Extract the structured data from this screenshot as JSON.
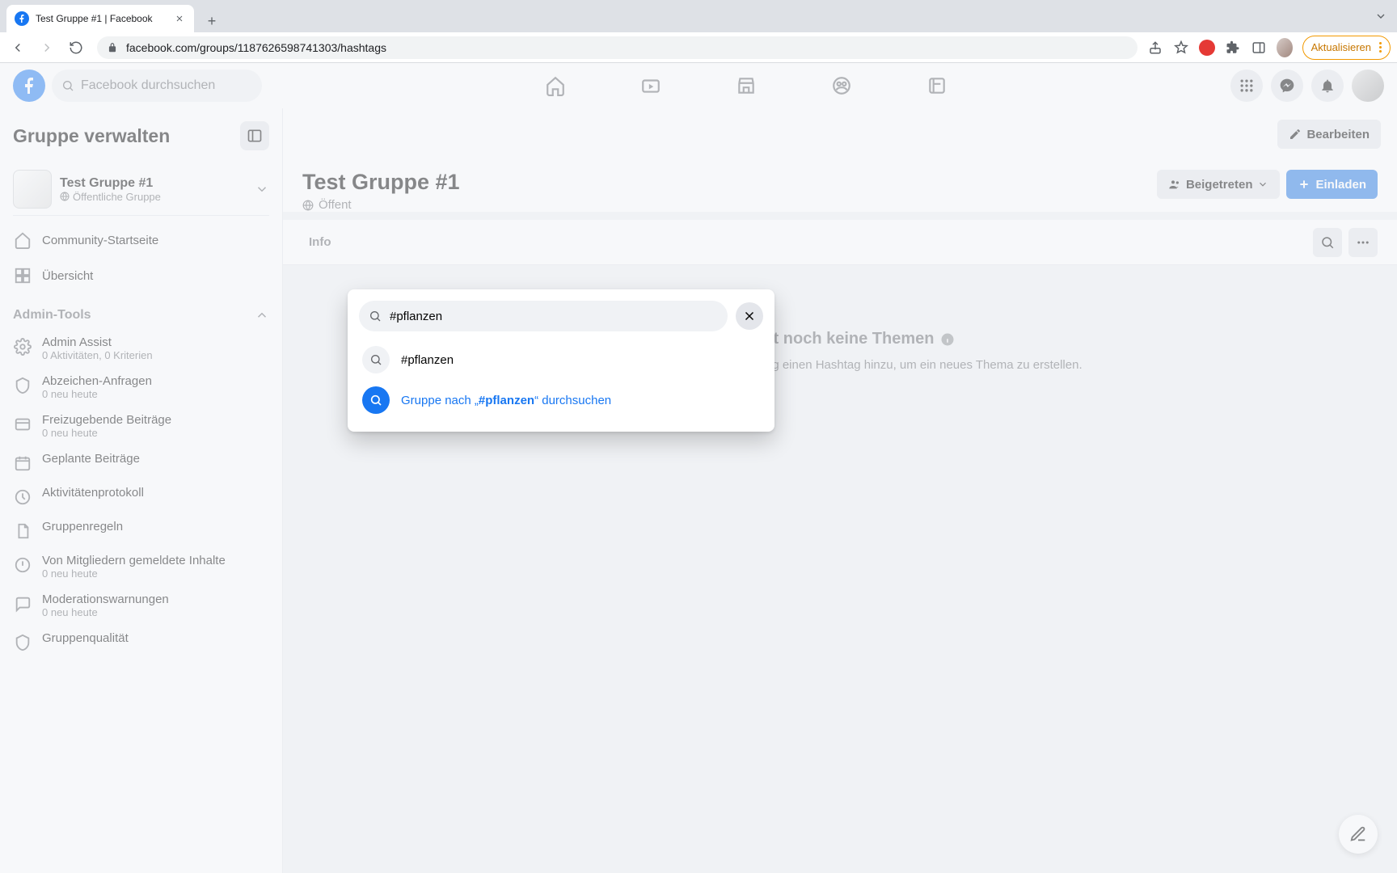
{
  "browser": {
    "tab_title": "Test Gruppe #1 | Facebook",
    "url": "facebook.com/groups/1187626598741303/hashtags",
    "update_label": "Aktualisieren"
  },
  "topnav": {
    "search_placeholder": "Facebook durchsuchen"
  },
  "sidebar": {
    "title": "Gruppe verwalten",
    "group": {
      "name": "Test Gruppe #1",
      "visibility": "Öffentliche Gruppe"
    },
    "items": [
      {
        "label": "Community-Startseite"
      },
      {
        "label": "Übersicht"
      }
    ],
    "admin_section": "Admin-Tools",
    "admin_items": [
      {
        "label": "Admin Assist",
        "sub": "0 Aktivitäten, 0 Kriterien"
      },
      {
        "label": "Abzeichen-Anfragen",
        "sub": "0 neu heute"
      },
      {
        "label": "Freizugebende Beiträge",
        "sub": "0 neu heute"
      },
      {
        "label": "Geplante Beiträge",
        "sub": ""
      },
      {
        "label": "Aktivitätenprotokoll",
        "sub": ""
      },
      {
        "label": "Gruppenregeln",
        "sub": ""
      },
      {
        "label": "Von Mitgliedern gemeldete Inhalte",
        "sub": "0 neu heute"
      },
      {
        "label": "Moderationswarnungen",
        "sub": "0 neu heute"
      },
      {
        "label": "Gruppenqualität",
        "sub": ""
      }
    ]
  },
  "main": {
    "edit_label": "Bearbeiten",
    "title": "Test Gruppe #1",
    "subtitle_prefix": "Öffent",
    "joined_label": "Beigetreten",
    "invite_label": "Einladen",
    "tabs": [
      "Info"
    ],
    "empty_h": "Es gibt noch keine Themen",
    "empty_p": "Füge zu deinem nächsten Beitrag einen Hashtag hinzu, um ein neues Thema zu erstellen."
  },
  "search": {
    "value": "#pflanzen",
    "suggestion_hashtag": "#pflanzen",
    "suggestion_full_pre": "Gruppe nach „",
    "suggestion_full_bold": "#pflanzen",
    "suggestion_full_post": "“ durchsuchen"
  }
}
